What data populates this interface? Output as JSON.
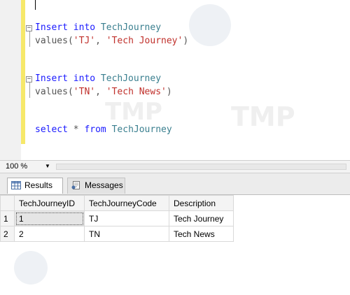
{
  "editor": {
    "lines": [
      {
        "id": "insert1_a",
        "parts": [
          [
            "kw",
            "Insert into "
          ],
          [
            "ident",
            "TechJourney"
          ]
        ]
      },
      {
        "id": "insert1_b",
        "parts": [
          [
            "punc",
            "values("
          ],
          [
            "str",
            "'TJ'"
          ],
          [
            "punc",
            ", "
          ],
          [
            "str",
            "'Tech Journey'"
          ],
          [
            "punc",
            ")"
          ]
        ]
      },
      {
        "id": "insert2_a",
        "parts": [
          [
            "kw",
            "Insert into "
          ],
          [
            "ident",
            "TechJourney"
          ]
        ]
      },
      {
        "id": "insert2_b",
        "parts": [
          [
            "punc",
            "values("
          ],
          [
            "str",
            "'TN'"
          ],
          [
            "punc",
            ", "
          ],
          [
            "str",
            "'Tech News'"
          ],
          [
            "punc",
            ")"
          ]
        ]
      },
      {
        "id": "select_a",
        "parts": [
          [
            "kw",
            "select "
          ],
          [
            "punc",
            "* "
          ],
          [
            "kw",
            "from "
          ],
          [
            "ident",
            "TechJourney"
          ]
        ]
      }
    ],
    "collapse_symbol": "−",
    "colors": {
      "keyword": "#1a1aff",
      "identifier": "#3a7f8f",
      "string": "#c0302b",
      "change_bar": "#f6e86a"
    }
  },
  "zoom": {
    "value": "100 %",
    "arrow": "▼"
  },
  "tabs": {
    "results_label": "Results",
    "messages_label": "Messages",
    "active": "Results"
  },
  "grid": {
    "columns": [
      "TechJourneyID",
      "TechJourneyCode",
      "Description"
    ],
    "rows": [
      {
        "num": "1",
        "cells": [
          "1",
          "TJ",
          "Tech Journey"
        ]
      },
      {
        "num": "2",
        "cells": [
          "2",
          "TN",
          "Tech News"
        ]
      }
    ]
  }
}
